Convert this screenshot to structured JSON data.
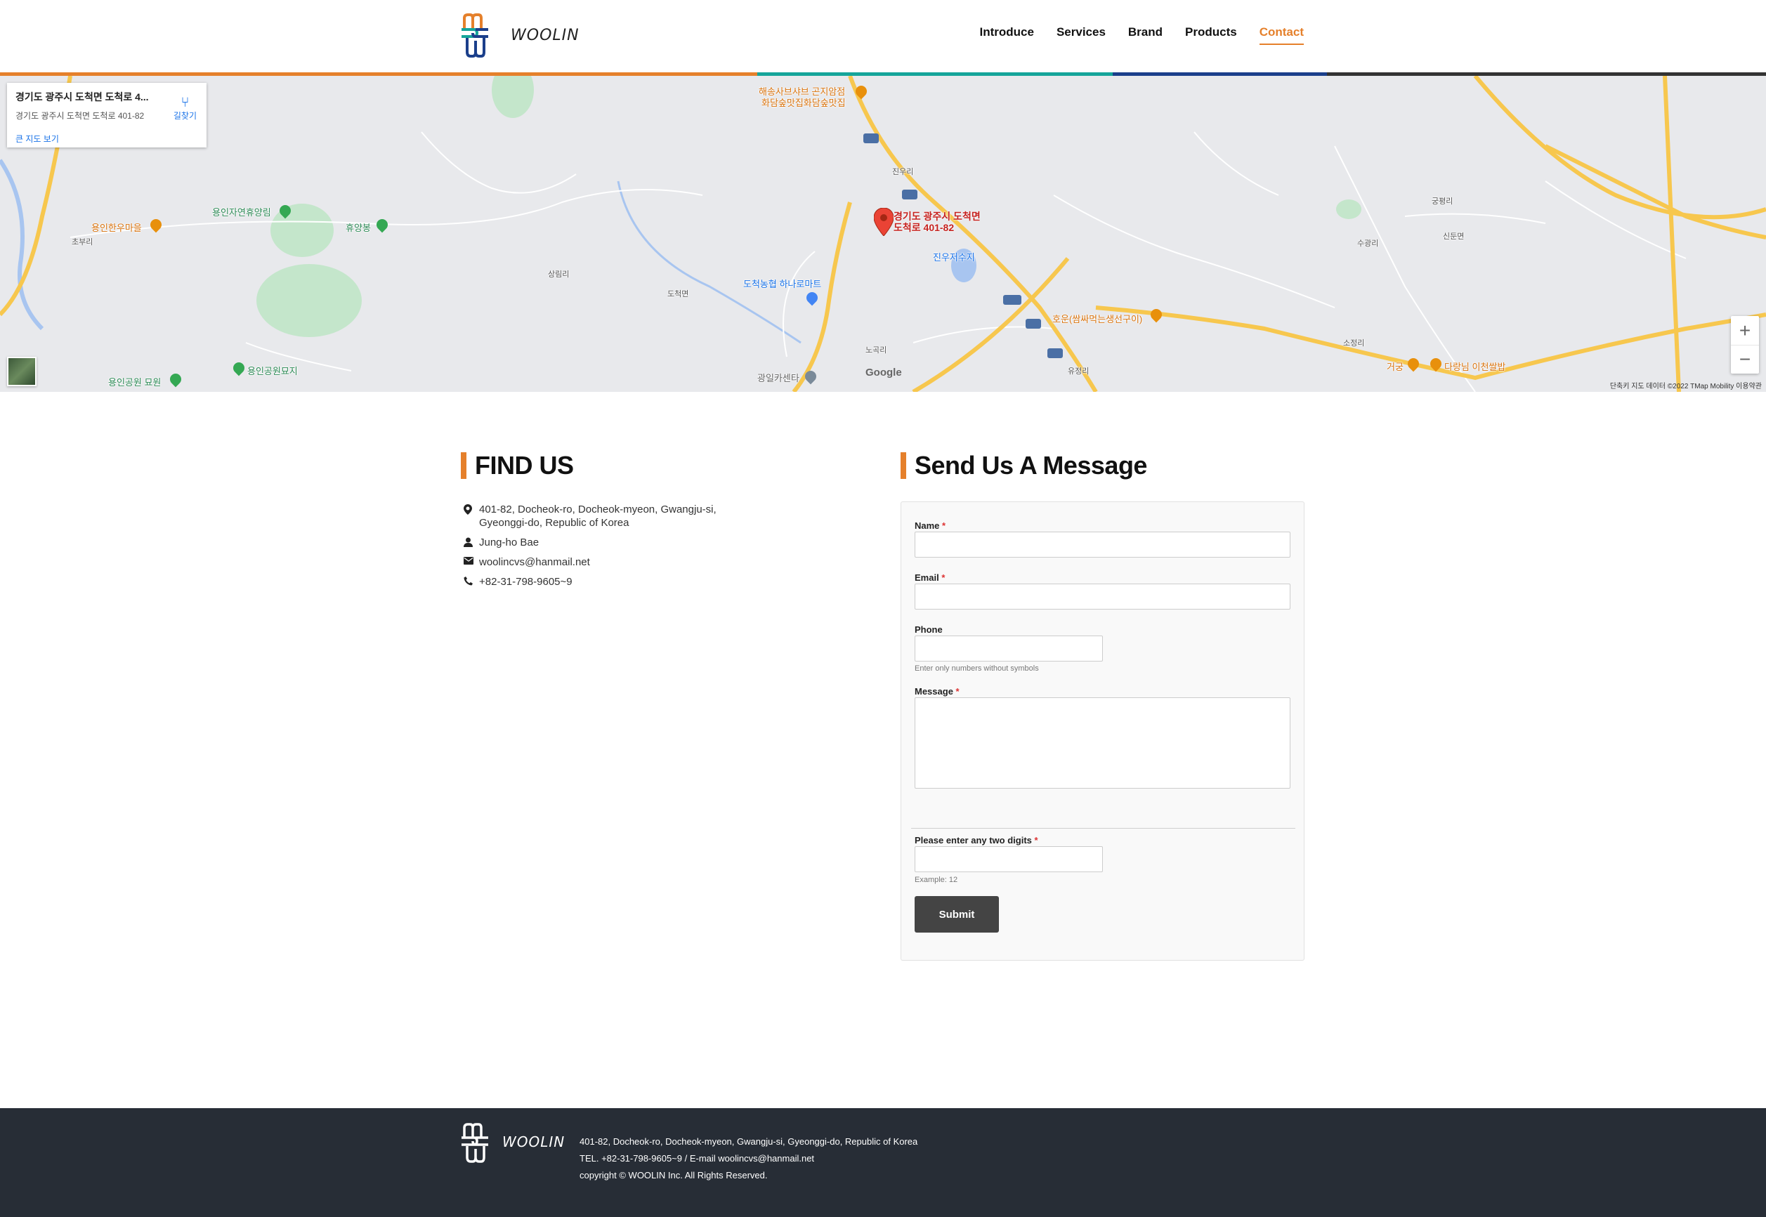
{
  "brand": {
    "name": "WOOLIN",
    "accent": "#e5802b",
    "teal": "#15a59a",
    "navy": "#1b3f8b",
    "footer_bg": "#272d36"
  },
  "nav": {
    "items": [
      {
        "label": "Introduce"
      },
      {
        "label": "Services"
      },
      {
        "label": "Brand"
      },
      {
        "label": "Products"
      },
      {
        "label": "Contact"
      }
    ],
    "active": "Contact"
  },
  "map": {
    "card_title": "경기도 광주시 도척면 도척로 4...",
    "card_address": "경기도 광주시 도척면 도척로 401-82",
    "card_link": "큰 지도 보기",
    "directions": "길찾기",
    "marker_label_line1": "경기도 광주시 도척면",
    "marker_label_line2": "도척로 401-82",
    "google": "Google",
    "footer": "단축키   지도 데이터 ©2022 TMap Mobility   이용약관",
    "zoom_in": "+",
    "zoom_out": "−",
    "places": {
      "p1": "해송사브샤브 곤지암점",
      "p2": "화담숲맛집화담숲맛집",
      "p3": "용인자연휴양림",
      "p4": "휴양봉",
      "p5": "용인한우마을",
      "p6": "도척농협 하나로마트",
      "p7": "진우저수지",
      "p8": "호운(쌈싸먹는생선구이)",
      "p9": "용인공원묘지",
      "p10": "용인공원 묘원",
      "p11": "광일카센타",
      "p12": "거궁",
      "p13": "다랑님 이천쌀밥",
      "p14": "진우리",
      "p15": "도척면",
      "p16": "상림리",
      "p17": "초부리",
      "p18": "노곡리",
      "p19": "유정리",
      "p20": "수광리",
      "p21": "신둔면",
      "p22": "소정리",
      "p23": "궁평리"
    }
  },
  "find_us": {
    "title": "FIND US",
    "address": "401-82, Docheok-ro, Docheok-myeon, Gwangju-si, Gyeonggi-do, Republic of Korea",
    "contact_person": "Jung-ho Bae",
    "email": "woolincvs@hanmail.net",
    "phone": "+82-31-798-9605~9"
  },
  "form": {
    "title": "Send Us A Message",
    "name_label": "Name",
    "email_label": "Email",
    "phone_label": "Phone",
    "phone_hint": "Enter only numbers without symbols",
    "message_label": "Message",
    "captcha_label": "Please enter any two digits",
    "captcha_hint": "Example: 12",
    "required_mark": "*",
    "submit_label": "Submit"
  },
  "footer": {
    "line1": "401-82, Docheok-ro, Docheok-myeon, Gwangju-si, Gyeonggi-do, Republic of Korea",
    "line2": "TEL. +82-31-798-9605~9 / E-mail woolincvs@hanmail.net",
    "line3": "copyright © WOOLIN Inc. All Rights Reserved."
  }
}
